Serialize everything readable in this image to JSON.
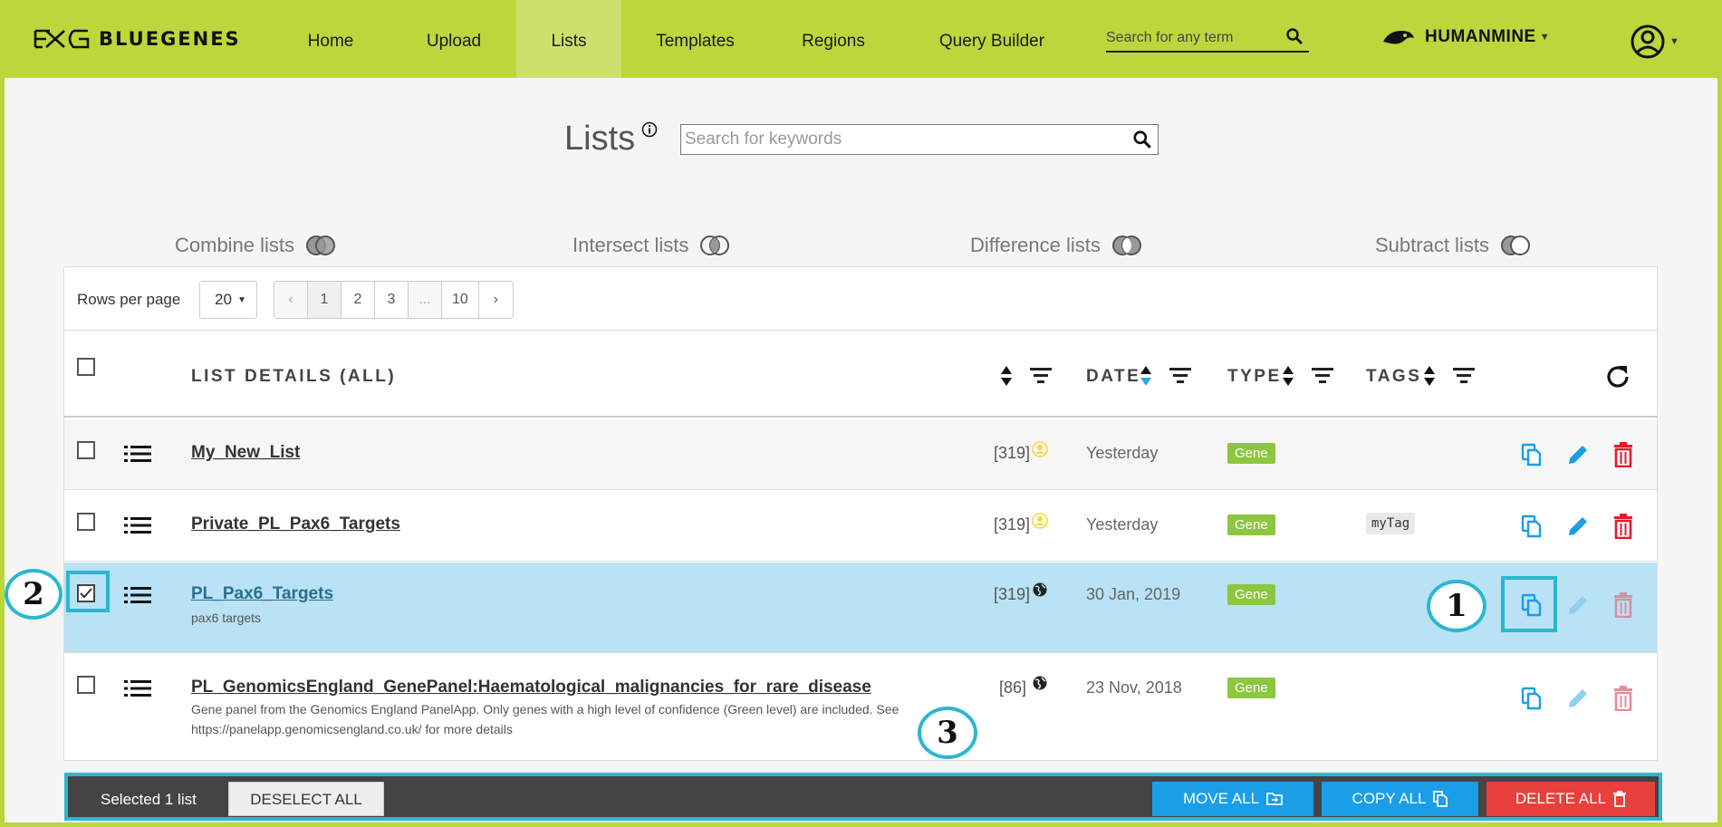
{
  "nav": {
    "brand": "BLUEGENES",
    "links": [
      "Home",
      "Upload",
      "Lists",
      "Templates",
      "Regions",
      "Query Builder"
    ],
    "active": "Lists",
    "search_placeholder": "Search for any term",
    "mine": "HUMANMINE"
  },
  "page": {
    "title": "Lists",
    "search_placeholder": "Search for keywords",
    "operations": [
      "Combine lists",
      "Intersect lists",
      "Difference lists",
      "Subtract lists"
    ]
  },
  "pager": {
    "rows_label": "Rows per page",
    "rows_value": "20",
    "prev": "‹",
    "pages": [
      "1",
      "2",
      "3",
      "...",
      "10"
    ],
    "next": "›"
  },
  "columns": {
    "details": "LIST DETAILS (ALL)",
    "date": "DATE",
    "type": "TYPE",
    "tags": "TAGS"
  },
  "rows": [
    {
      "title": "My_New_List",
      "description": "",
      "count": "[319]",
      "access": "private",
      "date": "Yesterday",
      "type": "Gene",
      "tag": "",
      "checked": false
    },
    {
      "title": "Private_PL_Pax6_Targets",
      "description": "",
      "count": "[319]",
      "access": "private",
      "date": "Yesterday",
      "type": "Gene",
      "tag": "myTag",
      "checked": false
    },
    {
      "title": "PL_Pax6_Targets",
      "description": "pax6 targets",
      "count": "[319]",
      "access": "public",
      "date": "30 Jan, 2019",
      "type": "Gene",
      "tag": "",
      "checked": true
    },
    {
      "title": "PL_GenomicsEngland_GenePanel:Haematological_malignancies_for_rare_disease",
      "description": "Gene panel from the Genomics England PanelApp. Only genes with a high level of confidence (Green level) are included. See https://panelapp.genomicsengland.co.uk/ for more details",
      "count": "[86]",
      "access": "public",
      "date": "23 Nov, 2018",
      "type": "Gene",
      "tag": "",
      "checked": false
    }
  ],
  "action_bar": {
    "selected_text": "Selected 1 list",
    "deselect": "DESELECT ALL",
    "move": "MOVE ALL",
    "copy": "COPY ALL",
    "delete": "DELETE ALL"
  },
  "annotations": {
    "one": "1",
    "two": "2",
    "three": "3"
  },
  "colors": {
    "navbar": "#bcd73b",
    "accent_cyan": "#2bb7cf",
    "selected_row": "#b9e2f5",
    "type_badge": "#8dc63f",
    "move_btn": "#1a9ee8",
    "copy_btn": "#1a9ee8",
    "delete_btn": "#e8403c",
    "edit_icon": "#1a9ee8",
    "trash_icon": "#e21b2c"
  },
  "icons": {
    "row_actions": [
      "copy-icon",
      "edit-icon",
      "trash-icon"
    ],
    "list": "list-icon",
    "refresh": "refresh-icon"
  }
}
